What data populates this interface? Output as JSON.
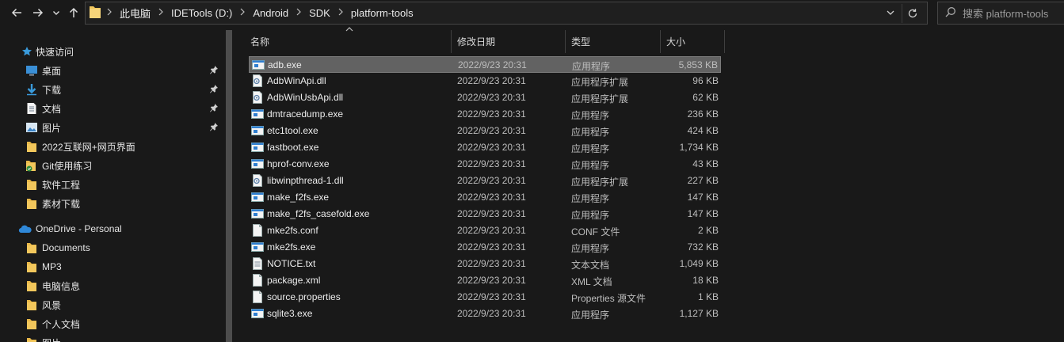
{
  "toolbar": {
    "back_icon": "arrow-left-icon",
    "forward_icon": "arrow-right-icon",
    "recent_icon": "chevron-down-icon",
    "up_icon": "arrow-up-icon"
  },
  "address": {
    "crumbs": [
      "此电脑",
      "IDETools (D:)",
      "Android",
      "SDK",
      "platform-tools"
    ]
  },
  "search": {
    "placeholder": "搜索 platform-tools"
  },
  "sidebar": {
    "quick_access": "快速访问",
    "items": [
      {
        "label": "桌面",
        "icon": "desktop-icon",
        "pinned": true
      },
      {
        "label": "下载",
        "icon": "download-icon",
        "pinned": true
      },
      {
        "label": "文档",
        "icon": "document-icon",
        "pinned": true
      },
      {
        "label": "图片",
        "icon": "picture-icon",
        "pinned": true
      },
      {
        "label": "2022互联网+网页界面",
        "icon": "folder-icon",
        "pinned": false
      },
      {
        "label": "Git使用练习",
        "icon": "git-folder-icon",
        "pinned": false
      },
      {
        "label": "软件工程",
        "icon": "folder-icon",
        "pinned": false
      },
      {
        "label": "素材下载",
        "icon": "folder-icon",
        "pinned": false
      }
    ],
    "onedrive": "OneDrive - Personal",
    "onedrive_items": [
      "Documents",
      "MP3",
      "电脑信息",
      "风景",
      "个人文档",
      "图片"
    ]
  },
  "columns": {
    "name": "名称",
    "date": "修改日期",
    "type": "类型",
    "size": "大小"
  },
  "files": [
    {
      "name": "adb.exe",
      "date": "2022/9/23 20:31",
      "type": "应用程序",
      "size": "5,853 KB",
      "icon": "exe-icon",
      "selected": true
    },
    {
      "name": "AdbWinApi.dll",
      "date": "2022/9/23 20:31",
      "type": "应用程序扩展",
      "size": "96 KB",
      "icon": "dll-icon"
    },
    {
      "name": "AdbWinUsbApi.dll",
      "date": "2022/9/23 20:31",
      "type": "应用程序扩展",
      "size": "62 KB",
      "icon": "dll-icon"
    },
    {
      "name": "dmtracedump.exe",
      "date": "2022/9/23 20:31",
      "type": "应用程序",
      "size": "236 KB",
      "icon": "exe-icon"
    },
    {
      "name": "etc1tool.exe",
      "date": "2022/9/23 20:31",
      "type": "应用程序",
      "size": "424 KB",
      "icon": "exe-icon"
    },
    {
      "name": "fastboot.exe",
      "date": "2022/9/23 20:31",
      "type": "应用程序",
      "size": "1,734 KB",
      "icon": "exe-icon"
    },
    {
      "name": "hprof-conv.exe",
      "date": "2022/9/23 20:31",
      "type": "应用程序",
      "size": "43 KB",
      "icon": "exe-icon"
    },
    {
      "name": "libwinpthread-1.dll",
      "date": "2022/9/23 20:31",
      "type": "应用程序扩展",
      "size": "227 KB",
      "icon": "dll-icon"
    },
    {
      "name": "make_f2fs.exe",
      "date": "2022/9/23 20:31",
      "type": "应用程序",
      "size": "147 KB",
      "icon": "exe-icon"
    },
    {
      "name": "make_f2fs_casefold.exe",
      "date": "2022/9/23 20:31",
      "type": "应用程序",
      "size": "147 KB",
      "icon": "exe-icon"
    },
    {
      "name": "mke2fs.conf",
      "date": "2022/9/23 20:31",
      "type": "CONF 文件",
      "size": "2 KB",
      "icon": "file-icon"
    },
    {
      "name": "mke2fs.exe",
      "date": "2022/9/23 20:31",
      "type": "应用程序",
      "size": "732 KB",
      "icon": "exe-icon"
    },
    {
      "name": "NOTICE.txt",
      "date": "2022/9/23 20:31",
      "type": "文本文档",
      "size": "1,049 KB",
      "icon": "text-file-icon"
    },
    {
      "name": "package.xml",
      "date": "2022/9/23 20:31",
      "type": "XML 文档",
      "size": "18 KB",
      "icon": "file-icon"
    },
    {
      "name": "source.properties",
      "date": "2022/9/23 20:31",
      "type": "Properties 源文件",
      "size": "1 KB",
      "icon": "file-icon"
    },
    {
      "name": "sqlite3.exe",
      "date": "2022/9/23 20:31",
      "type": "应用程序",
      "size": "1,127 KB",
      "icon": "exe-icon"
    }
  ],
  "colors": {
    "background": "#191919",
    "selected_row": "#626262",
    "folder": "#f2c75c",
    "accent_blue": "#3a9bdc"
  }
}
